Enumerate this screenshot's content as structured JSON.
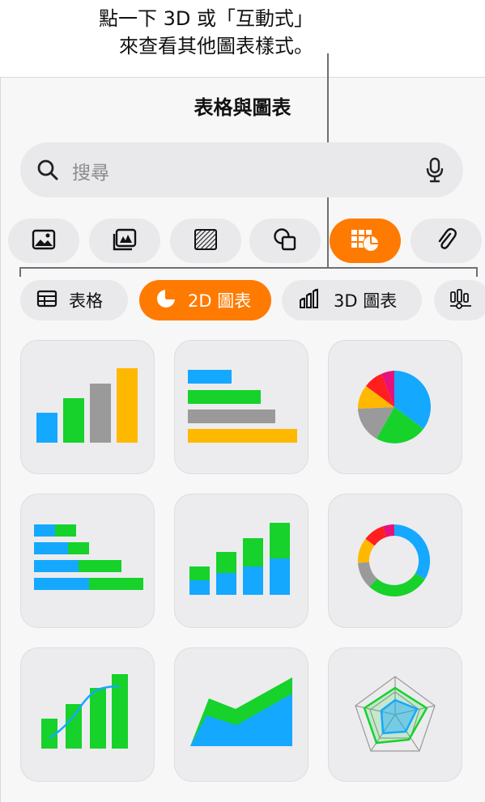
{
  "callout": {
    "line1": "點一下 3D 或「互動式」",
    "line2": "來查看其他圖表樣式。"
  },
  "panel": {
    "title": "表格與圖表",
    "search": {
      "placeholder": "搜尋"
    }
  },
  "toolbar": {
    "items": [
      {
        "icon": "photo-icon",
        "active": false
      },
      {
        "icon": "media-gallery-icon",
        "active": false
      },
      {
        "icon": "shape-fill-icon",
        "active": false
      },
      {
        "icon": "shapes-icon",
        "active": false
      },
      {
        "icon": "table-chart-icon",
        "active": true
      },
      {
        "icon": "paperclip-icon",
        "active": false
      }
    ],
    "active_color": "#ff7a00"
  },
  "tabs": [
    {
      "label": "表格",
      "icon": "table-icon",
      "active": false
    },
    {
      "label": "2D 圖表",
      "icon": "pie-chart-icon",
      "active": true
    },
    {
      "label": "3D 圖表",
      "icon": "3d-bar-chart-icon",
      "active": false
    },
    {
      "label": "",
      "icon": "interactive-chart-icon",
      "active": false
    }
  ],
  "chart_styles": [
    "column-chart",
    "bar-chart",
    "pie-chart",
    "stacked-bar-chart",
    "stacked-column-chart",
    "donut-chart",
    "line-column-chart",
    "area-chart",
    "radar-chart"
  ],
  "colors": {
    "blue": "#15a8ff",
    "green": "#16d22a",
    "gray": "#9a9a9a",
    "yellow": "#ffb800",
    "red": "#ff1f1f",
    "magenta": "#e6127a",
    "accent": "#ff7a00"
  }
}
